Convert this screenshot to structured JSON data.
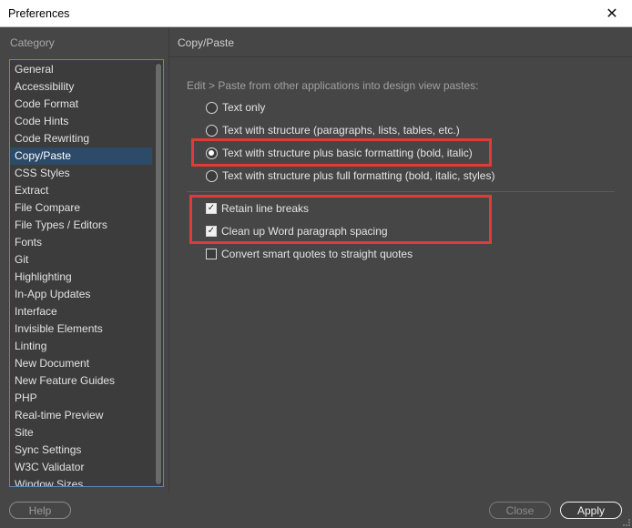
{
  "window": {
    "title": "Preferences",
    "close_glyph": "✕"
  },
  "sidebar": {
    "header": "Category",
    "selected": "Copy/Paste",
    "items": [
      "General",
      "Accessibility",
      "Code Format",
      "Code Hints",
      "Code Rewriting",
      "Copy/Paste",
      "CSS Styles",
      "Extract",
      "File Compare",
      "File Types / Editors",
      "Fonts",
      "Git",
      "Highlighting",
      "In-App Updates",
      "Interface",
      "Invisible Elements",
      "Linting",
      "New Document",
      "New Feature Guides",
      "PHP",
      "Real-time Preview",
      "Site",
      "Sync Settings",
      "W3C Validator",
      "Window Sizes"
    ]
  },
  "panel": {
    "title": "Copy/Paste",
    "intro": "Edit > Paste from other applications into design view pastes:",
    "radios": [
      {
        "label": "Text only",
        "checked": false
      },
      {
        "label": "Text with structure (paragraphs, lists, tables, etc.)",
        "checked": false
      },
      {
        "label": "Text with structure plus basic formatting (bold, italic)",
        "checked": true
      },
      {
        "label": "Text with structure plus full formatting (bold, italic, styles)",
        "checked": false
      }
    ],
    "checkboxes": [
      {
        "label": "Retain line breaks",
        "checked": true
      },
      {
        "label": "Clean up Word paragraph spacing",
        "checked": true
      },
      {
        "label": "Convert smart quotes to straight quotes",
        "checked": false
      }
    ]
  },
  "footer": {
    "help": "Help",
    "close": "Close",
    "apply": "Apply"
  },
  "colors": {
    "highlight": "#e03a3a",
    "selection": "#2d4a69",
    "background": "#464646"
  }
}
